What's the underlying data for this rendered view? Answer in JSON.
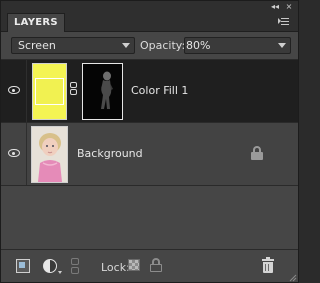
{
  "panel": {
    "tab_label": "LAYERS",
    "collapse_glyph": "◂◂",
    "close_glyph": "×"
  },
  "controls": {
    "blend_mode": "Screen",
    "opacity_label": "Opacity:",
    "opacity_value": "80%"
  },
  "layers": [
    {
      "name": "Color Fill 1",
      "type": "fill",
      "visible": true,
      "selected": true,
      "fill_color": "#f4f453"
    },
    {
      "name": "Background",
      "type": "image",
      "visible": true,
      "selected": false,
      "locked": true
    }
  ],
  "toolbar": {
    "lock_label": "Lock:"
  },
  "icons": {
    "panel_menu": "panel-menu-icon",
    "visibility": "eye-icon",
    "link": "chain-icon",
    "lock": "lock-icon",
    "new_layer": "new-layer-icon",
    "adjustment": "adjustment-layer-icon",
    "link_layers": "link-layers-icon",
    "lock_transparent": "lock-transparent-pixels-icon",
    "lock_all": "lock-all-icon",
    "delete": "trash-icon"
  }
}
